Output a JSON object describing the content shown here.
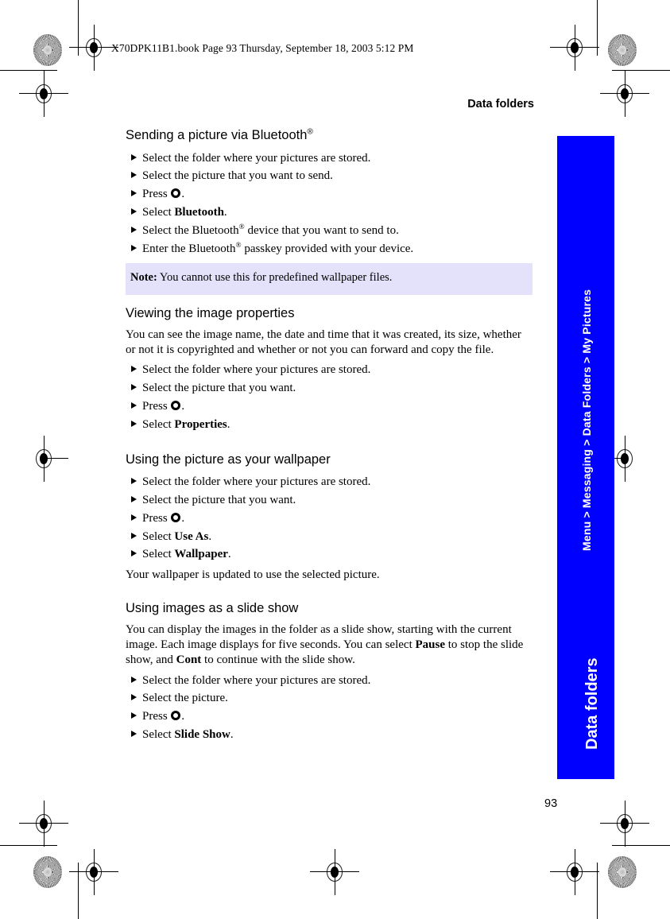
{
  "print_marks": {
    "file_banner": "X70DPK11B1.book  Page 93  Thursday, September 18, 2003  5:12 PM"
  },
  "header": {
    "running_head": "Data folders"
  },
  "sections": [
    {
      "id": "sending-bluetooth",
      "heading_pre": "Sending a picture via Bluetooth",
      "heading_sup": "®",
      "steps": [
        "Select the folder where your pictures are stored.",
        "Select the picture that you want to send.",
        "PRESS_KEY",
        "SELECT_BOLD:Bluetooth",
        "Select the Bluetooth® device that you want to send to.",
        "Enter the Bluetooth® passkey provided with your device."
      ]
    },
    {
      "id": "viewing-properties",
      "heading": "Viewing the image properties",
      "intro": "You can see the image name, the date and time that it was created, its size, whether or not it is copyrighted and whether or not you can forward and copy the file.",
      "steps": [
        "Select the folder where your pictures are stored.",
        "Select the picture that you want.",
        "PRESS_KEY",
        "SELECT_BOLD:Properties"
      ]
    },
    {
      "id": "using-wallpaper",
      "heading": "Using the picture as your wallpaper",
      "steps": [
        "Select the folder where your pictures are stored.",
        "Select the picture that you want.",
        "PRESS_KEY",
        "SELECT_BOLD:Use As",
        "SELECT_BOLD:Wallpaper"
      ],
      "outro": "Your wallpaper is updated to use the selected picture."
    },
    {
      "id": "slide-show",
      "heading": "Using images as a slide show",
      "steps": [
        "Select the folder where your pictures are stored.",
        "Select the picture.",
        "PRESS_KEY",
        "SELECT_BOLD:Slide Show"
      ]
    }
  ],
  "text": {
    "s1_step1": "Select the folder where your pictures are stored.",
    "s1_step2": "Select the picture that you want to send.",
    "s1_step3_press": "Press",
    "s1_step4_select": "Select",
    "s1_step4_bold": "Bluetooth",
    "s1_step5_a": "Select the Bluetooth",
    "s1_step5_b": " device that you want to send to.",
    "s1_step6_a": "Enter the Bluetooth",
    "s1_step6_b": " passkey provided with your device.",
    "note_label": "Note:",
    "note_body": "You cannot use this for predefined wallpaper files.",
    "s2_heading": "Viewing the image properties",
    "s2_intro": "You can see the image name, the date and time that it was created, its size, whether or not it is copyrighted and whether or not you can forward and copy the file.",
    "s2_step1": "Select the folder where your pictures are stored.",
    "s2_step2": "Select the picture that you want.",
    "s2_step4_bold": "Properties",
    "s3_heading": "Using the picture as your wallpaper",
    "s3_step1": "Select the folder where your pictures are stored.",
    "s3_step2": "Select the picture that you want.",
    "s3_step4_bold": "Use As",
    "s3_step5_bold": "Wallpaper",
    "s3_outro": "Your wallpaper is updated to use the selected picture.",
    "s4_heading": "Using images as a slide show",
    "s4_intro_a": "You can display the images in the folder as a slide show, starting with the current image. Each image displays for five seconds. You can select ",
    "s4_intro_bold1": "Pause",
    "s4_intro_b": " to stop the slide show, and ",
    "s4_intro_bold2": "Cont",
    "s4_intro_c": " to continue with the slide show.",
    "s4_step1": "Select the folder where your pictures are stored.",
    "s4_step2": "Select the picture.",
    "s4_step4_bold": "Slide Show",
    "heading1_main": "Sending a picture via Bluetooth",
    "registered_mark": "®",
    "press_word": "Press",
    "select_word": "Select",
    "period": "."
  },
  "side_tab": {
    "breadcrumb": "Menu > Messaging > Data Folders > My Pictures",
    "title": "Data folders",
    "background_color": "#0000FF",
    "text_color": "#FFFFFF"
  },
  "footer": {
    "page_number": "93"
  },
  "colors": {
    "note_background": "#E4E2FA",
    "tab_blue": "#0000FF",
    "text": "#000000"
  }
}
